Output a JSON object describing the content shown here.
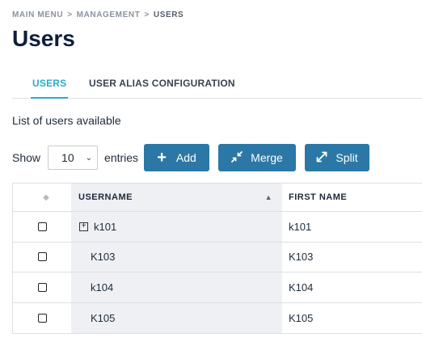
{
  "breadcrumb": {
    "items": [
      "MAIN MENU",
      "MANAGEMENT",
      "USERS"
    ],
    "separator": ">"
  },
  "page": {
    "title": "Users"
  },
  "tabs": [
    {
      "label": "USERS",
      "active": true
    },
    {
      "label": "USER ALIAS CONFIGURATION",
      "active": false
    }
  ],
  "subtitle": "List of users available",
  "controls": {
    "show_label": "Show",
    "entries_value": "10",
    "entries_label": "entries"
  },
  "buttons": {
    "add": {
      "label": "Add",
      "icon": "plus-icon"
    },
    "merge": {
      "label": "Merge",
      "icon": "merge-arrows-icon"
    },
    "split": {
      "label": "Split",
      "icon": "expand-arrows-icon"
    }
  },
  "table": {
    "columns": [
      "USERNAME",
      "FIRST NAME"
    ],
    "sort": {
      "column": "USERNAME",
      "direction": "ascending"
    },
    "rows": [
      {
        "username": "k101",
        "first_name": "k101",
        "expandable": true
      },
      {
        "username": "K103",
        "first_name": "K103",
        "expandable": false
      },
      {
        "username": "k104",
        "first_name": "K104",
        "expandable": false
      },
      {
        "username": "K105",
        "first_name": "K105",
        "expandable": false
      }
    ]
  },
  "colors": {
    "accent": "#2aaccb",
    "button": "#2b78a6",
    "title": "#0f1f3a",
    "username_column_bg": "#eef0f4"
  }
}
